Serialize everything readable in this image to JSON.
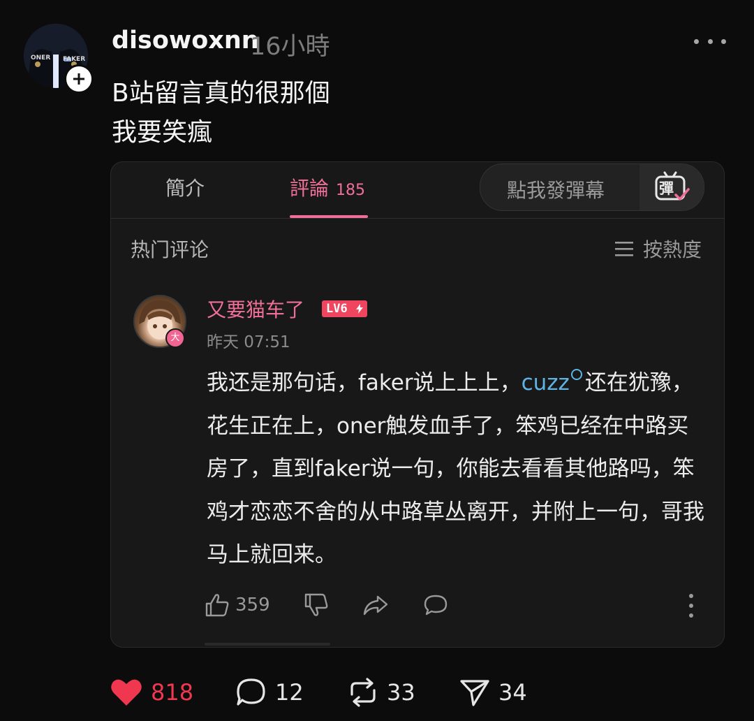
{
  "post": {
    "username": "disowoxnn",
    "time": "16小時",
    "text_line1": "B站留言真的很那個",
    "text_line2": "我要笑瘋",
    "avatar_jersey_left": "ONER",
    "avatar_jersey_right": "FAKER"
  },
  "embed": {
    "tabs": [
      {
        "label": "簡介"
      },
      {
        "label": "評論",
        "count": "185",
        "active": true
      }
    ],
    "danmaku_placeholder": "點我發彈幕",
    "danmaku_icon_label": "彈",
    "section_title": "热门评论",
    "sort_label": "按熱度",
    "comment": {
      "username": "又要猫车了",
      "level": "LV6",
      "vip_badge": "大",
      "time": "昨天 07:51",
      "text_before_link": "我还是那句话，faker说上上上，",
      "link_text": "cuzz",
      "text_after_link": "还在犹豫，花生正在上，oner触发血手了，笨鸡已经在中路买房了，直到faker说一句，你能去看看其他路吗，笨鸡才恋恋不舍的从中路草丛离开，并附上一句，哥我马上就回来。",
      "likes": "359"
    }
  },
  "engagement": {
    "likes": "818",
    "comments": "12",
    "reposts": "33",
    "shares": "34"
  },
  "colors": {
    "accent_pink": "#ef6f98",
    "like_red": "#f03750",
    "link_blue": "#5fb4e4"
  }
}
